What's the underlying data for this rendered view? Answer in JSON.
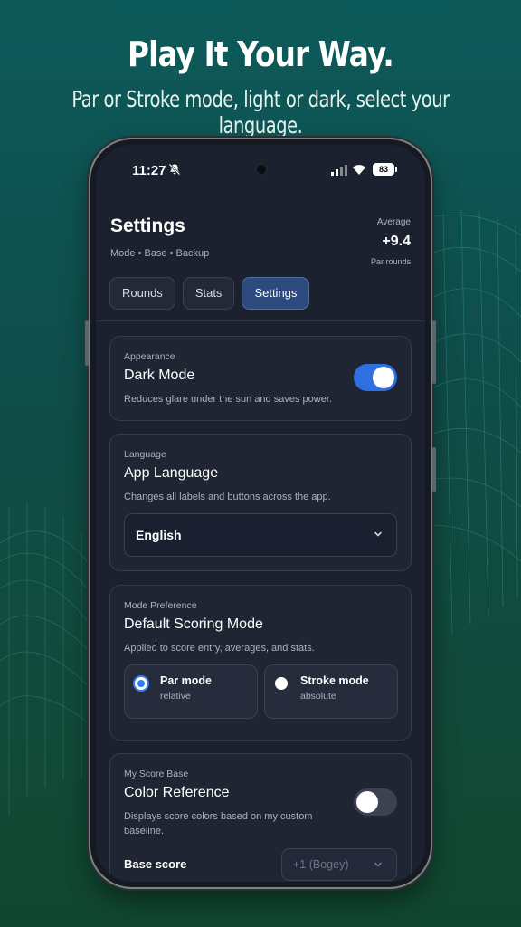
{
  "promo": {
    "headline": "Play It Your Way.",
    "subline": "Par or Stroke mode, light or dark, select your language."
  },
  "status_bar": {
    "time": "11:27",
    "battery": "83"
  },
  "header": {
    "title": "Settings",
    "subtitle": "Mode • Base • Backup",
    "average_label": "Average",
    "average_value": "+9.4",
    "average_sub": "Par rounds"
  },
  "tabs": [
    {
      "label": "Rounds",
      "active": false
    },
    {
      "label": "Stats",
      "active": false
    },
    {
      "label": "Settings",
      "active": true
    }
  ],
  "appearance": {
    "section": "Appearance",
    "title": "Dark Mode",
    "description": "Reduces glare under the sun and saves power.",
    "enabled": true
  },
  "language": {
    "section": "Language",
    "title": "App Language",
    "description": "Changes all labels and buttons across the app.",
    "selected": "English"
  },
  "mode": {
    "section": "Mode Preference",
    "title": "Default Scoring Mode",
    "description": "Applied to score entry, averages, and stats.",
    "options": [
      {
        "name": "Par mode",
        "sub": "relative",
        "selected": true
      },
      {
        "name": "Stroke mode",
        "sub": "absolute",
        "selected": false
      }
    ]
  },
  "score_base": {
    "section": "My Score Base",
    "title": "Color Reference",
    "description": "Displays score colors based on my custom baseline.",
    "enabled": false,
    "base_label": "Base score",
    "base_value": "+1 (Bogey)"
  },
  "colors": {
    "accent": "#2f6fe0",
    "active_tab": "#2c4a7e",
    "card_bg": "#1f2533",
    "screen_bg": "#1c2130"
  }
}
